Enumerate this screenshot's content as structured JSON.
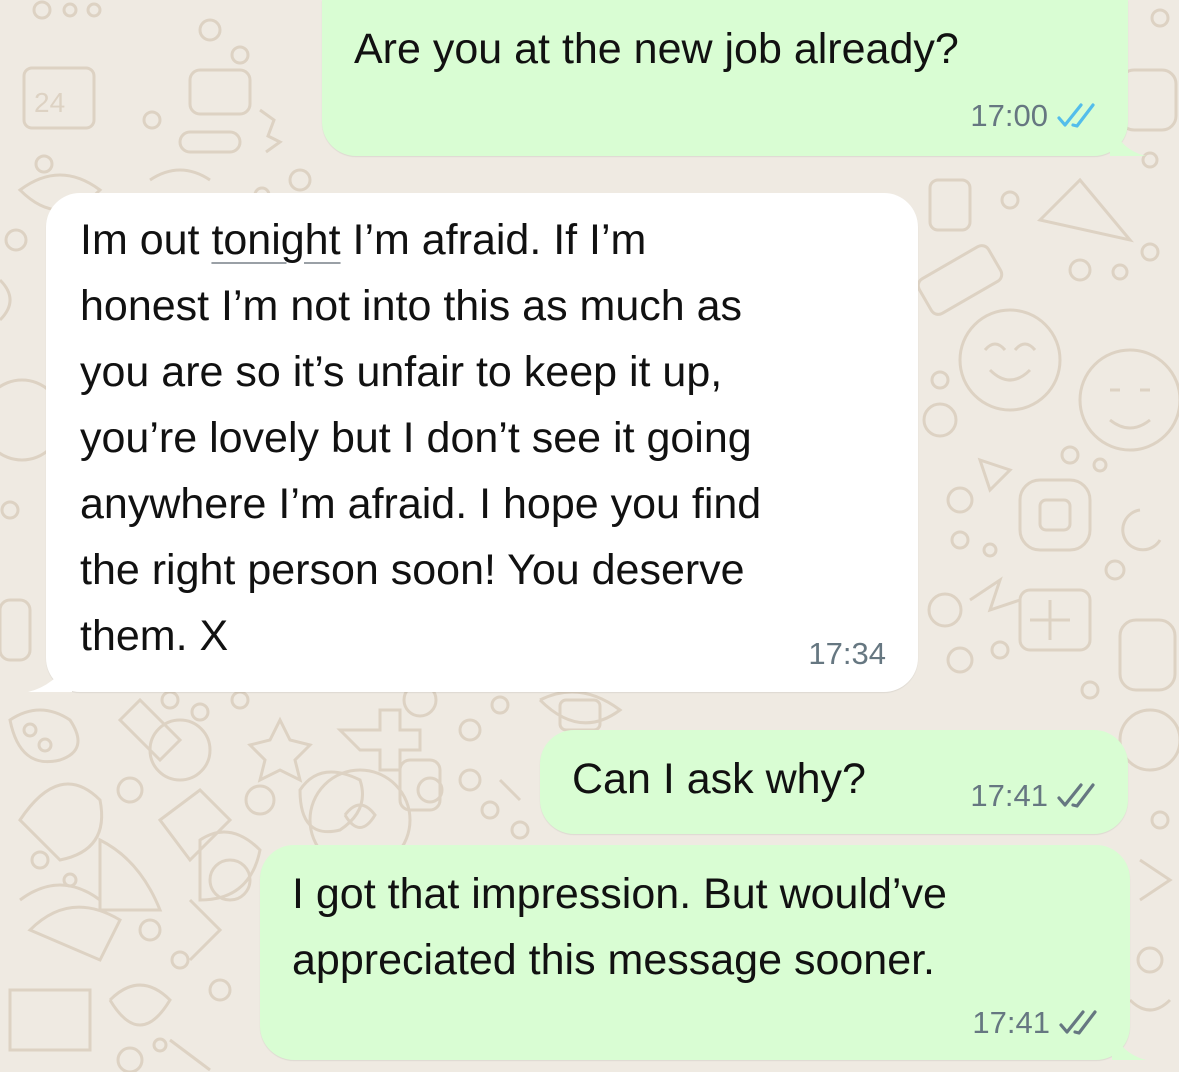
{
  "colors": {
    "chat_background": "#efeae2",
    "outgoing_bubble": "#d9fdd3",
    "incoming_bubble": "#ffffff",
    "timestamp": "#667781",
    "read_ticks": "#53bdeb",
    "delivered_ticks": "#667781"
  },
  "messages": [
    {
      "direction": "outgoing",
      "text": "Are you at the new job already?",
      "time": "17:00",
      "status": "read",
      "status_icon": "double-check-read-icon"
    },
    {
      "direction": "incoming",
      "text_before_underline": "Im out ",
      "underlined_word": "tonight",
      "text_after_underline": " I’m afraid. If I’m\nhonest I’m not into this as much as\nyou are so it’s unfair to keep it up,\nyou’re lovely but I don’t see it going\nanywhere I’m afraid. I hope you find\nthe right person soon! You deserve\nthem. X",
      "time": "17:34"
    },
    {
      "direction": "outgoing",
      "text": "Can I ask why?",
      "time": "17:41",
      "status": "delivered",
      "status_icon": "double-check-delivered-icon"
    },
    {
      "direction": "outgoing",
      "text": "I got that impression. But would’ve\nappreciated this message sooner.",
      "time": "17:41",
      "status": "delivered",
      "status_icon": "double-check-delivered-icon"
    }
  ]
}
